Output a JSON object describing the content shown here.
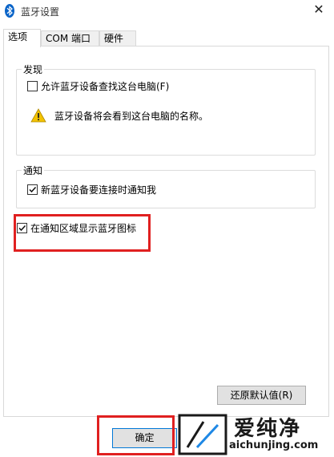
{
  "window": {
    "title": "蓝牙设置",
    "close_glyph": "✕",
    "bluetooth_icon": "bluetooth-icon"
  },
  "tabs": [
    {
      "label": "选项",
      "active": true
    },
    {
      "label": "COM 端口",
      "active": false
    },
    {
      "label": "硬件",
      "active": false
    }
  ],
  "discovery": {
    "group_label": "发现",
    "allow_discovery_label": "允许蓝牙设备查找这台电脑(F)",
    "allow_discovery_checked": false,
    "warning_text": "蓝牙设备将会看到这台电脑的名称。"
  },
  "notification": {
    "group_label": "通知",
    "notify_new_device_label": "新蓝牙设备要连接时通知我",
    "notify_new_device_checked": true
  },
  "tray": {
    "show_icon_label": "在通知区域显示蓝牙图标",
    "show_icon_checked": true
  },
  "buttons": {
    "restore_defaults": "还原默认值(R)",
    "ok": "确定"
  },
  "watermark": {
    "brand": "爱纯净",
    "url": "aichunjing.com"
  },
  "colors": {
    "highlight": "#e02020",
    "warning": "#f2c200",
    "bluetooth": "#0a64c8"
  }
}
